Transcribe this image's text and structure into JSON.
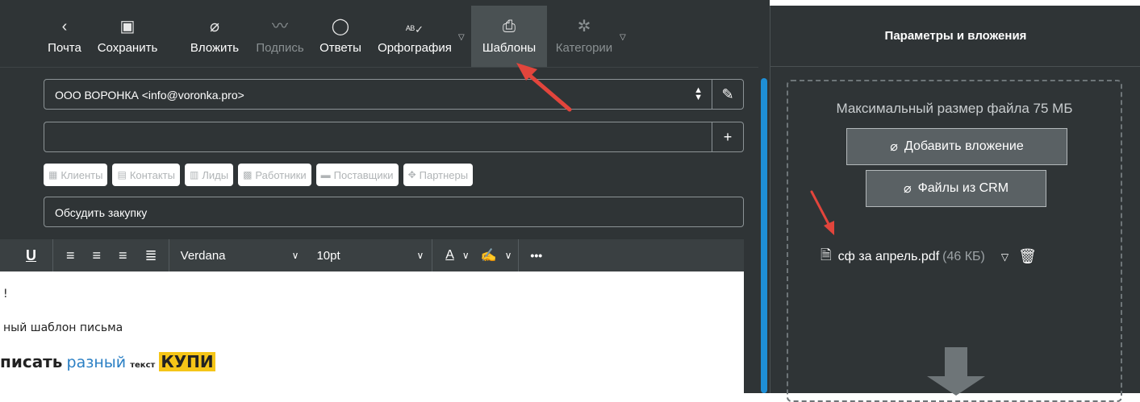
{
  "toolbar": {
    "items": [
      {
        "label": "Почта",
        "icon": "‹",
        "name": "mail"
      },
      {
        "label": "Сохранить",
        "icon": "▣",
        "name": "save"
      },
      {
        "label": "Вложить",
        "icon": "⌀",
        "name": "attach"
      },
      {
        "label": "Подпись",
        "icon": "〰",
        "name": "signature"
      },
      {
        "label": "Ответы",
        "icon": "◯",
        "name": "replies"
      },
      {
        "label": "Орфография",
        "icon": "ᴬᴮ✓",
        "name": "spelling"
      },
      {
        "label": "Шаблоны",
        "icon": "⎙",
        "name": "templates"
      },
      {
        "label": "Категории",
        "icon": "✲",
        "name": "categories"
      }
    ]
  },
  "compose": {
    "from_value": "ООО ВОРОНКА <info@voronka.pro>",
    "to_value": "",
    "subject_value": "Обсудить закупку",
    "add_label": "+"
  },
  "tags": [
    {
      "label": "Клиенты",
      "icon": "▦"
    },
    {
      "label": "Контакты",
      "icon": "▤"
    },
    {
      "label": "Лиды",
      "icon": "▥"
    },
    {
      "label": "Работники",
      "icon": "▩"
    },
    {
      "label": "Поставщики",
      "icon": "▬"
    },
    {
      "label": "Партнеры",
      "icon": "✥"
    }
  ],
  "format": {
    "font": "Verdana",
    "size": "10pt",
    "more": "•••"
  },
  "body": {
    "line1": "!",
    "line2": "ный шаблон письма",
    "line3_a": "писать",
    "line3_b": "разный",
    "line3_c": "текст",
    "line3_d": "КУПИ"
  },
  "attachments": {
    "title": "Параметры и вложения",
    "max_size": "Максимальный размер файла 75 МБ",
    "add_button": "Добавить вложение",
    "crm_button": "Файлы из CRM",
    "file_name": "сф за апрель.pdf",
    "file_size": "(46 КБ)"
  },
  "colors": {
    "panel_bg": "#2f3436",
    "accent": "#1e8fd6",
    "arrow": "#e2453c",
    "highlight": "#f5c518"
  }
}
